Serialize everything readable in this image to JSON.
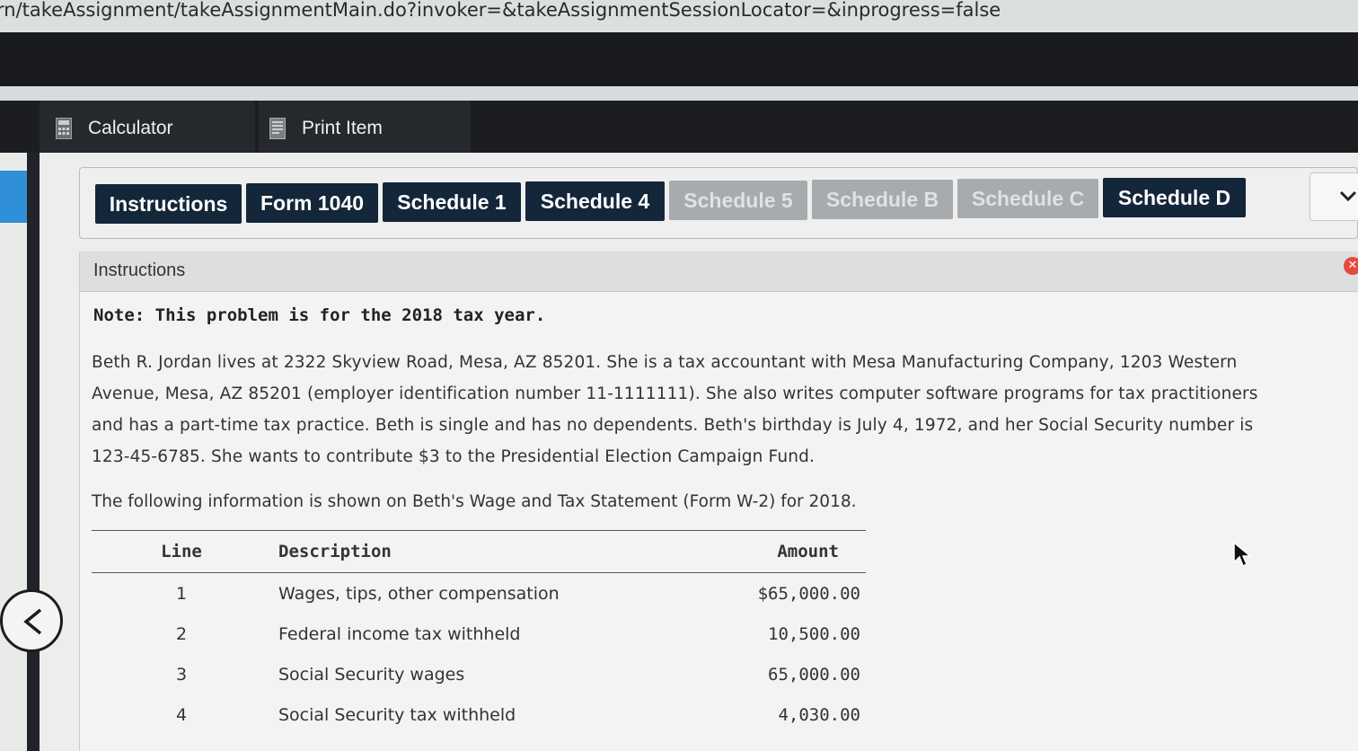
{
  "browser": {
    "url": "rn/takeAssignment/takeAssignmentMain.do?invoker=&takeAssignmentSessionLocator=&inprogress=false"
  },
  "toolbar": {
    "calculator_label": "Calculator",
    "print_label": "Print Item"
  },
  "tabs": [
    {
      "label": "Instructions",
      "enabled": true
    },
    {
      "label": "Form 1040",
      "enabled": true
    },
    {
      "label": "Schedule 1",
      "enabled": true
    },
    {
      "label": "Schedule 4",
      "enabled": true
    },
    {
      "label": "Schedule 5",
      "enabled": false
    },
    {
      "label": "Schedule B",
      "enabled": false
    },
    {
      "label": "Schedule C",
      "enabled": false
    },
    {
      "label": "Schedule D",
      "enabled": true
    }
  ],
  "content": {
    "header": "Instructions",
    "note": "Note: This problem is for the 2018 tax year.",
    "paragraph_lines": [
      "Beth R. Jordan lives at 2322 Skyview Road, Mesa, AZ 85201. She is a tax accountant with Mesa Manufacturing Company, 1203 Western",
      "Avenue, Mesa, AZ 85201 (employer identification number 11-1111111). She also writes computer software programs for tax practitioners",
      "and has a part-time tax practice. Beth is single and has no dependents. Beth's birthday is July 4, 1972, and her Social Security number is",
      "123-45-6785. She wants to contribute $3 to the Presidential Election Campaign Fund."
    ],
    "following_text": "The following information is shown on Beth's Wage and Tax Statement (Form W-2) for 2018.",
    "table": {
      "headers": {
        "line": "Line",
        "description": "Description",
        "amount": "Amount"
      },
      "rows": [
        {
          "line": "1",
          "description": "Wages, tips, other compensation",
          "amount": "$65,000.00"
        },
        {
          "line": "2",
          "description": "Federal income tax withheld",
          "amount": "10,500.00"
        },
        {
          "line": "3",
          "description": "Social Security wages",
          "amount": "65,000.00"
        },
        {
          "line": "4",
          "description": "Social Security tax withheld",
          "amount": "4,030.00"
        }
      ]
    }
  },
  "colors": {
    "tab_active": "#14263a",
    "tab_disabled": "#a7abae",
    "toolbar": "#1b1d20",
    "accent_blue": "#2f8fd8",
    "close_red": "#e64a3c"
  },
  "icons": [
    "calculator-icon",
    "print-icon",
    "chevron-down-icon",
    "close-icon",
    "back-arrow-icon",
    "mouse-cursor-icon"
  ]
}
